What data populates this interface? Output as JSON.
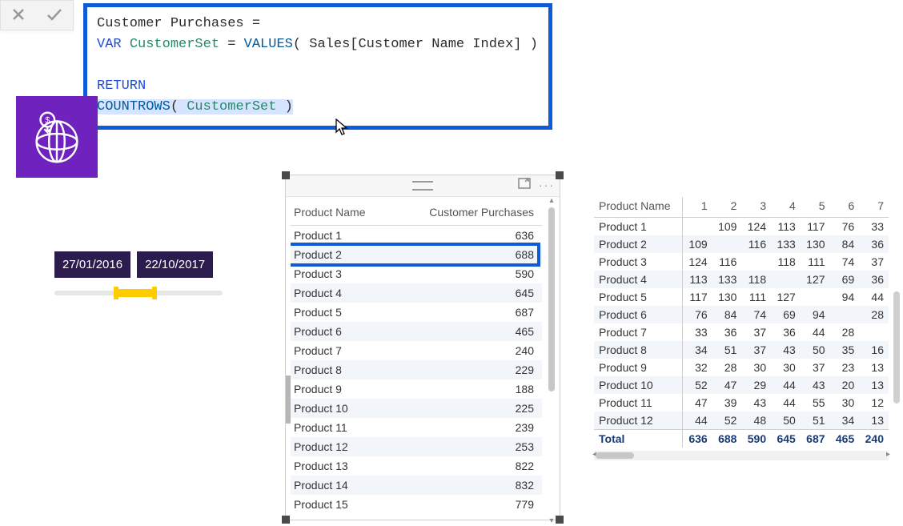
{
  "formula": {
    "measure_name": "Customer Purchases",
    "equals": " =",
    "kw_var": "VAR",
    "var_name": "CustomerSet",
    "assign": " = ",
    "fn_values": "VALUES",
    "values_arg": " Sales[Customer Name Index] ",
    "kw_return": "RETURN",
    "fn_countrows": "COUNTROWS",
    "countrows_arg": "CustomerSet"
  },
  "slicer": {
    "start": "27/01/2016",
    "end": "22/10/2017"
  },
  "table1": {
    "columns": [
      "Product Name",
      "Customer Purchases"
    ],
    "rows": [
      {
        "name": "Product 1",
        "value": "636"
      },
      {
        "name": "Product 2",
        "value": "688",
        "highlight": true
      },
      {
        "name": "Product 3",
        "value": "590"
      },
      {
        "name": "Product 4",
        "value": "645"
      },
      {
        "name": "Product 5",
        "value": "687"
      },
      {
        "name": "Product 6",
        "value": "465"
      },
      {
        "name": "Product 7",
        "value": "240"
      },
      {
        "name": "Product 8",
        "value": "229"
      },
      {
        "name": "Product 9",
        "value": "188"
      },
      {
        "name": "Product 10",
        "value": "225"
      },
      {
        "name": "Product 11",
        "value": "239"
      },
      {
        "name": "Product 12",
        "value": "253"
      },
      {
        "name": "Product 13",
        "value": "822"
      },
      {
        "name": "Product 14",
        "value": "832"
      },
      {
        "name": "Product 15",
        "value": "779"
      }
    ]
  },
  "matrix": {
    "row_header": "Product Name",
    "col_headers": [
      "1",
      "2",
      "3",
      "4",
      "5",
      "6",
      "7"
    ],
    "rows": [
      {
        "name": "Product 1",
        "v": [
          "",
          "109",
          "124",
          "113",
          "117",
          "76",
          "33"
        ]
      },
      {
        "name": "Product 2",
        "v": [
          "109",
          "",
          "116",
          "133",
          "130",
          "84",
          "36"
        ]
      },
      {
        "name": "Product 3",
        "v": [
          "124",
          "116",
          "",
          "118",
          "111",
          "74",
          "37"
        ]
      },
      {
        "name": "Product 4",
        "v": [
          "113",
          "133",
          "118",
          "",
          "127",
          "69",
          "36"
        ]
      },
      {
        "name": "Product 5",
        "v": [
          "117",
          "130",
          "111",
          "127",
          "",
          "94",
          "44"
        ]
      },
      {
        "name": "Product 6",
        "v": [
          "76",
          "84",
          "74",
          "69",
          "94",
          "",
          "28"
        ]
      },
      {
        "name": "Product 7",
        "v": [
          "33",
          "36",
          "37",
          "36",
          "44",
          "28",
          ""
        ]
      },
      {
        "name": "Product 8",
        "v": [
          "34",
          "51",
          "37",
          "43",
          "50",
          "35",
          "16"
        ]
      },
      {
        "name": "Product 9",
        "v": [
          "32",
          "28",
          "30",
          "30",
          "37",
          "23",
          "13"
        ]
      },
      {
        "name": "Product 10",
        "v": [
          "52",
          "47",
          "29",
          "44",
          "43",
          "20",
          "13"
        ]
      },
      {
        "name": "Product 11",
        "v": [
          "47",
          "39",
          "43",
          "44",
          "55",
          "30",
          "12"
        ]
      },
      {
        "name": "Product 12",
        "v": [
          "44",
          "52",
          "48",
          "50",
          "51",
          "34",
          "13"
        ]
      }
    ],
    "total_label": "Total",
    "total": [
      "636",
      "688",
      "590",
      "645",
      "687",
      "465",
      "240"
    ]
  }
}
